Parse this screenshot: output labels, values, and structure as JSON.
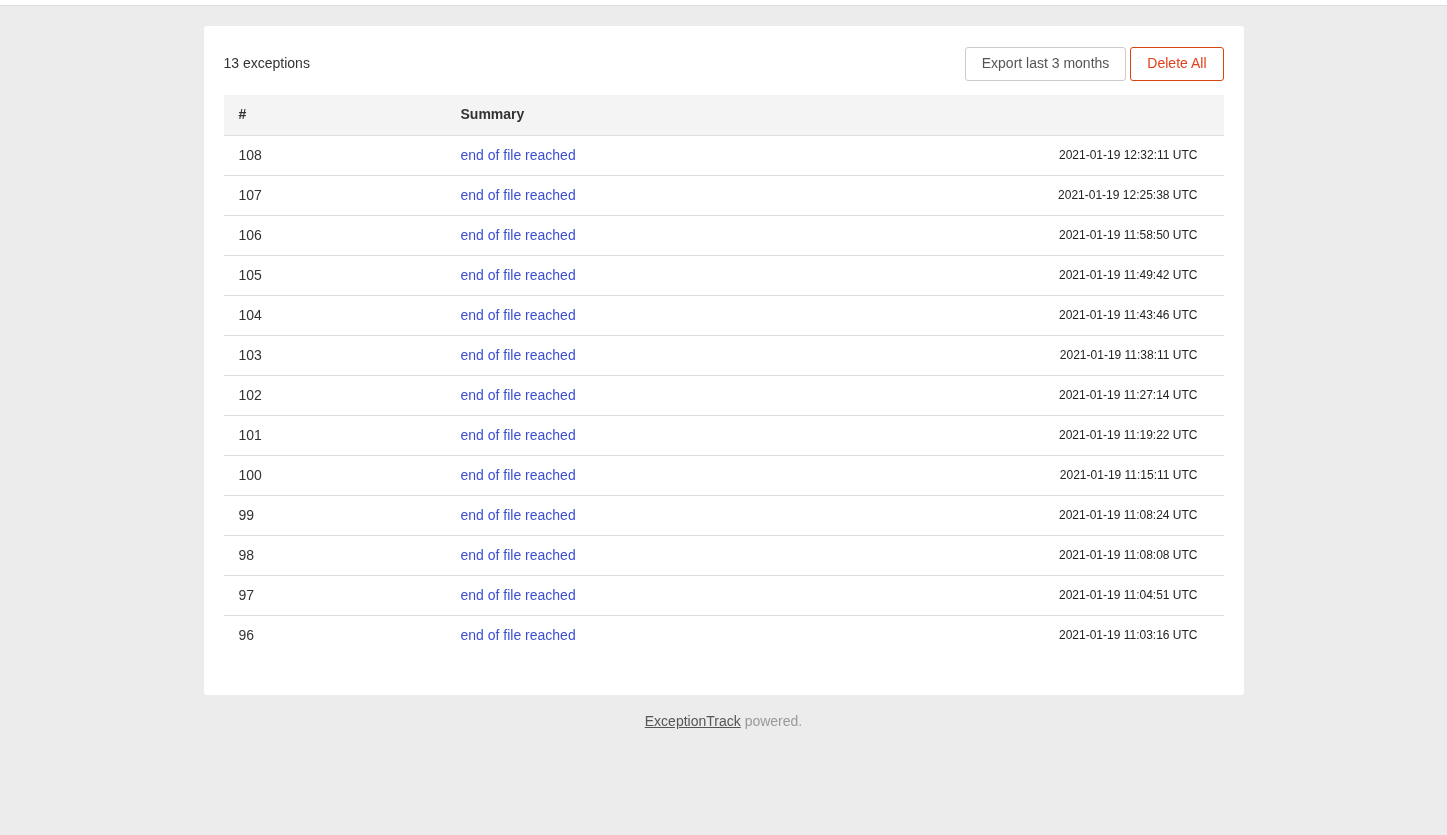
{
  "count_label": "13 exceptions",
  "buttons": [
    {
      "label": "Export last 3 months",
      "kind": "default"
    },
    {
      "label": "Delete All",
      "kind": "danger"
    }
  ],
  "table": {
    "columns": [
      "#",
      "Summary"
    ],
    "rows": [
      {
        "id": "108",
        "summary": "end of file reached",
        "time": "2021-01-19 12:32:11 UTC"
      },
      {
        "id": "107",
        "summary": "end of file reached",
        "time": "2021-01-19 12:25:38 UTC"
      },
      {
        "id": "106",
        "summary": "end of file reached",
        "time": "2021-01-19 11:58:50 UTC"
      },
      {
        "id": "105",
        "summary": "end of file reached",
        "time": "2021-01-19 11:49:42 UTC"
      },
      {
        "id": "104",
        "summary": "end of file reached",
        "time": "2021-01-19 11:43:46 UTC"
      },
      {
        "id": "103",
        "summary": "end of file reached",
        "time": "2021-01-19 11:38:11 UTC"
      },
      {
        "id": "102",
        "summary": "end of file reached",
        "time": "2021-01-19 11:27:14 UTC"
      },
      {
        "id": "101",
        "summary": "end of file reached",
        "time": "2021-01-19 11:19:22 UTC"
      },
      {
        "id": "100",
        "summary": "end of file reached",
        "time": "2021-01-19 11:15:11 UTC"
      },
      {
        "id": "99",
        "summary": "end of file reached",
        "time": "2021-01-19 11:08:24 UTC"
      },
      {
        "id": "98",
        "summary": "end of file reached",
        "time": "2021-01-19 11:08:08 UTC"
      },
      {
        "id": "97",
        "summary": "end of file reached",
        "time": "2021-01-19 11:04:51 UTC"
      },
      {
        "id": "96",
        "summary": "end of file reached",
        "time": "2021-01-19 11:03:16 UTC"
      }
    ]
  },
  "footer": {
    "link": "ExceptionTrack",
    "text": "powered."
  }
}
